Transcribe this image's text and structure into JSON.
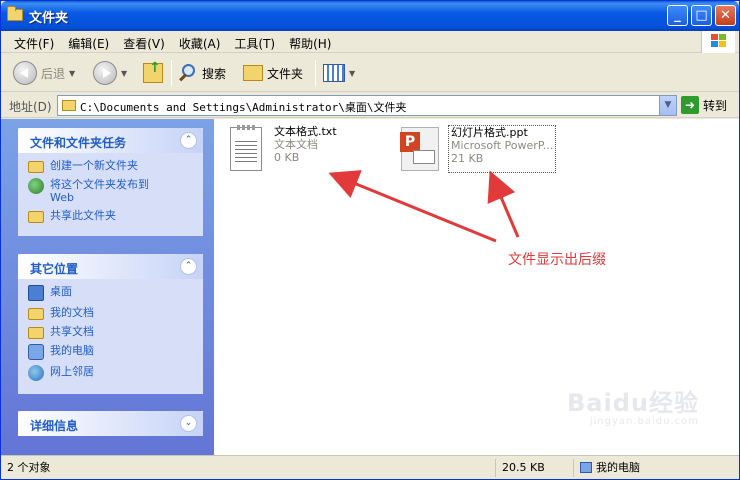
{
  "window": {
    "title": "文件夹"
  },
  "menu": [
    "文件(F)",
    "编辑(E)",
    "查看(V)",
    "收藏(A)",
    "工具(T)",
    "帮助(H)"
  ],
  "toolbar": {
    "back": "后退",
    "search": "搜索",
    "folders": "文件夹"
  },
  "address": {
    "label": "地址(D)",
    "value": "C:\\Documents and Settings\\Administrator\\桌面\\文件夹",
    "go": "转到"
  },
  "sidebar": {
    "tasks": {
      "title": "文件和文件夹任务",
      "items": [
        {
          "label": "创建一个新文件夹",
          "icon": "new-folder-icon"
        },
        {
          "label": "将这个文件夹发布到\nWeb",
          "icon": "publish-web-icon"
        },
        {
          "label": "共享此文件夹",
          "icon": "share-folder-icon"
        }
      ]
    },
    "places": {
      "title": "其它位置",
      "items": [
        {
          "label": "桌面",
          "icon": "desktop-icon"
        },
        {
          "label": "我的文档",
          "icon": "my-documents-icon"
        },
        {
          "label": "共享文档",
          "icon": "shared-documents-icon"
        },
        {
          "label": "我的电脑",
          "icon": "my-computer-icon"
        },
        {
          "label": "网上邻居",
          "icon": "network-places-icon"
        }
      ]
    },
    "details": {
      "title": "详细信息"
    }
  },
  "files": [
    {
      "name": "文本格式.txt",
      "type": "文本文档",
      "size": "0 KB",
      "icon": "text-file-icon"
    },
    {
      "name": "幻灯片格式.ppt",
      "type": "Microsoft PowerP...",
      "size": "21 KB",
      "icon": "ppt-file-icon"
    }
  ],
  "annotation": {
    "text": "文件显示出后缀",
    "color": "#e23a3a"
  },
  "watermark": {
    "text": "Baidu经验",
    "sub": "jingyan.baidu.com"
  },
  "status": {
    "objects": "2 个对象",
    "size": "20.5 KB",
    "location": "我的电脑"
  }
}
